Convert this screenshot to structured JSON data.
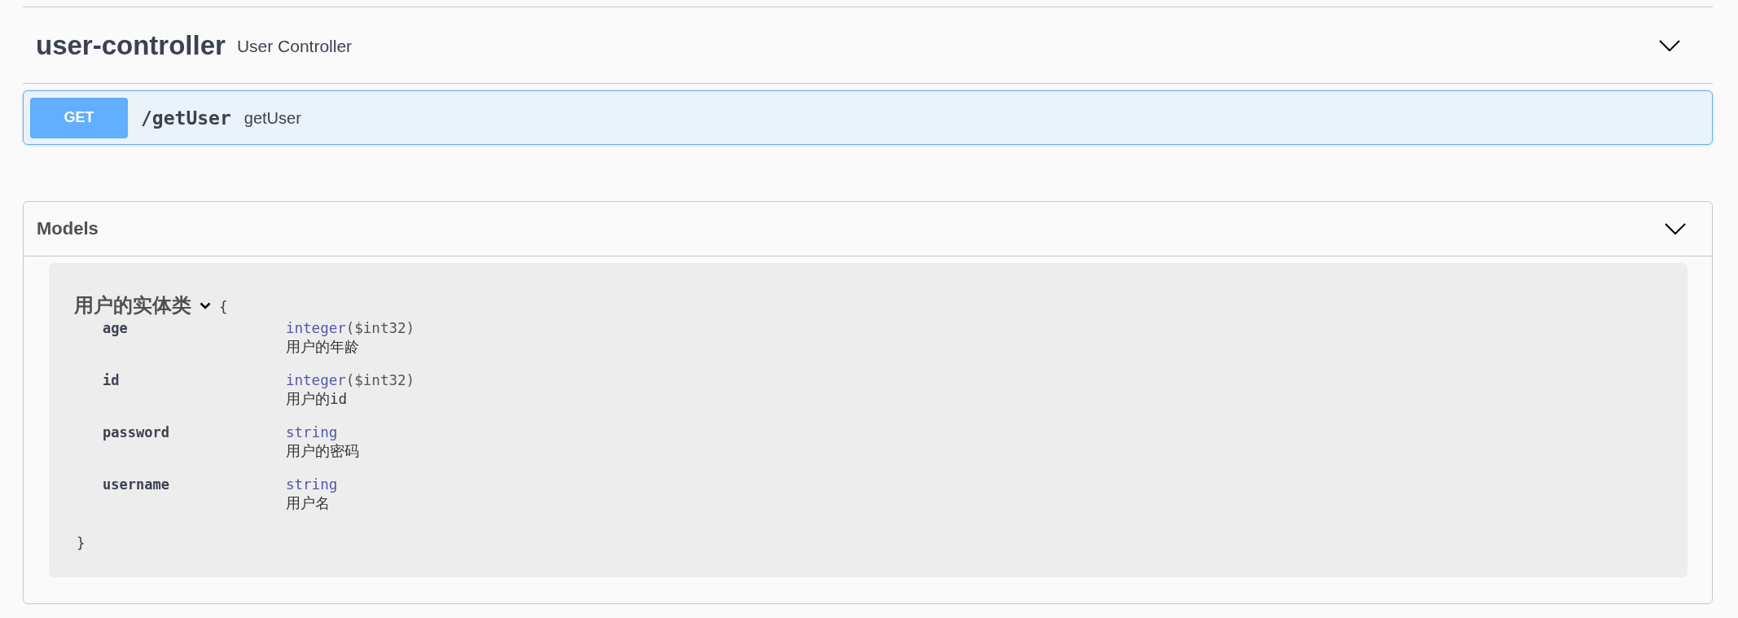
{
  "tag": {
    "name": "user-controller",
    "description": "User Controller",
    "expanded": true
  },
  "operations": [
    {
      "method": "GET",
      "path": "/getUser",
      "summary": "getUser",
      "color": "#61affe"
    }
  ],
  "models": {
    "title": "Models",
    "expanded": true,
    "items": [
      {
        "name": "用户的实体类",
        "expanded": true,
        "open_brace": "{",
        "close_brace": "}",
        "properties": [
          {
            "name": "age",
            "type": "integer",
            "format": "($int32)",
            "description": "用户的年龄"
          },
          {
            "name": "id",
            "type": "integer",
            "format": "($int32)",
            "description": "用户的id"
          },
          {
            "name": "password",
            "type": "string",
            "description": "用户的密码"
          },
          {
            "name": "username",
            "type": "string",
            "description": "用户名"
          }
        ]
      }
    ]
  }
}
